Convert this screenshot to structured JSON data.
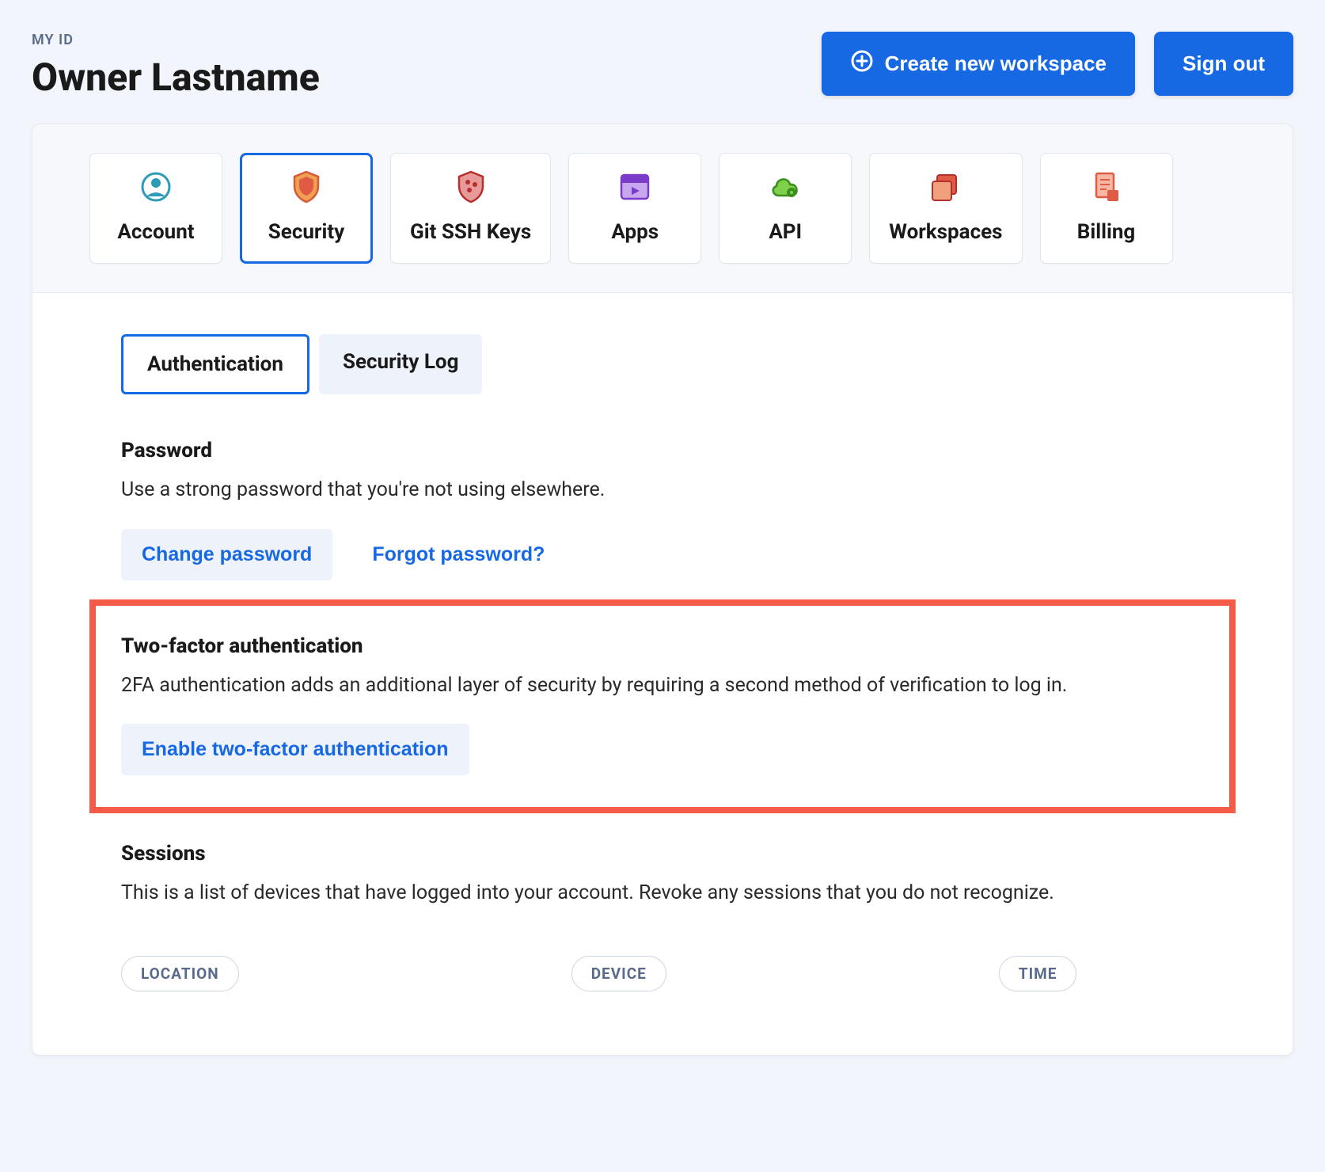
{
  "header": {
    "eyebrow": "MY ID",
    "owner_name": "Owner Lastname",
    "create_workspace_label": "Create new workspace",
    "sign_out_label": "Sign out"
  },
  "nav": {
    "items": [
      {
        "key": "account",
        "label": "Account",
        "icon": "user-circle-icon",
        "active": false
      },
      {
        "key": "security",
        "label": "Security",
        "icon": "shield-icon",
        "active": true
      },
      {
        "key": "gitssh",
        "label": "Git SSH Keys",
        "icon": "shield-dots-icon",
        "active": false
      },
      {
        "key": "apps",
        "label": "Apps",
        "icon": "app-window-icon",
        "active": false
      },
      {
        "key": "api",
        "label": "API",
        "icon": "cloud-gear-icon",
        "active": false
      },
      {
        "key": "workspaces",
        "label": "Workspaces",
        "icon": "stacked-docs-icon",
        "active": false
      },
      {
        "key": "billing",
        "label": "Billing",
        "icon": "receipt-icon",
        "active": false
      }
    ]
  },
  "subtabs": {
    "items": [
      {
        "label": "Authentication",
        "active": true
      },
      {
        "label": "Security Log",
        "active": false
      }
    ]
  },
  "password": {
    "title": "Password",
    "desc": "Use a strong password that you're not using elsewhere.",
    "change_label": "Change password",
    "forgot_label": "Forgot password?"
  },
  "twofa": {
    "title": "Two-factor authentication",
    "desc": "2FA authentication adds an additional layer of security by requiring a second method of verification to log in.",
    "enable_label": "Enable two-factor authentication"
  },
  "sessions": {
    "title": "Sessions",
    "desc": "This is a list of devices that have logged into your account. Revoke any sessions that you do not recognize.",
    "columns": [
      "LOCATION",
      "DEVICE",
      "TIME"
    ]
  }
}
